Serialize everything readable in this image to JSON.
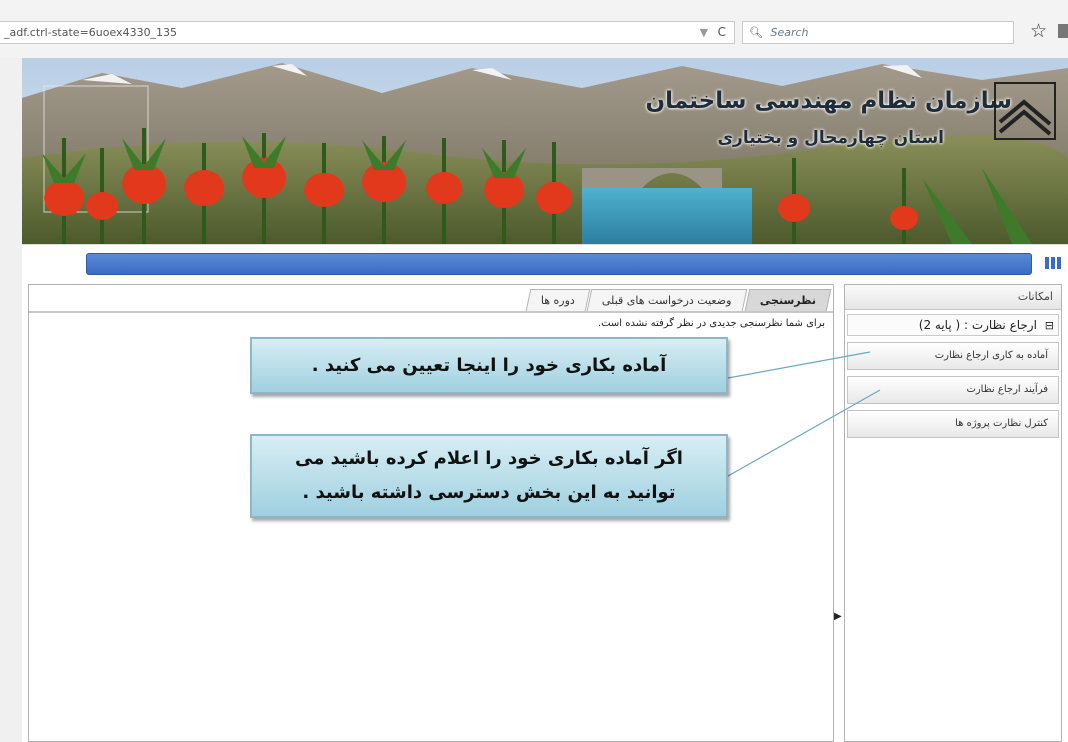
{
  "browser": {
    "url": "_adf.ctrl-state=6uoex4330_135",
    "url_icons": "▼",
    "refresh_icon": "C",
    "search_placeholder": "Search"
  },
  "banner": {
    "title": "سازمان نظام مهندسی ساختمان",
    "subtitle": "استان چهارمحال و بختیاری"
  },
  "tabs": [
    {
      "label": "نظرسنجی",
      "active": true
    },
    {
      "label": "وضعیت درخواست های قبلی",
      "active": false
    },
    {
      "label": "دوره ها",
      "active": false
    }
  ],
  "main": {
    "no_survey_message": "برای شما نظرسنجی جدیدی در نظر گرفته نشده است."
  },
  "sidebar": {
    "title": "امکانات",
    "group_label": "ارجاع نظارت : ( پایه 2)",
    "items": [
      {
        "label": "آماده به کاری ارجاع نظارت"
      },
      {
        "label": "فرآیند ارجاع نظارت"
      },
      {
        "label": "کنترل نظارت پروژه ها"
      }
    ]
  },
  "callouts": {
    "first": "آماده بکاری خود را اینجا تعیین می کنید .",
    "second_line1": "اگر آماده بکاری خود را اعلام کرده باشید می",
    "second_line2": "توانید به این بخش دسترسی داشته باشید ."
  },
  "colors": {
    "nav_bar": "#3a6cc4",
    "callout_bg": "#a8d5e3",
    "tab_active": "#d8d8d8"
  }
}
